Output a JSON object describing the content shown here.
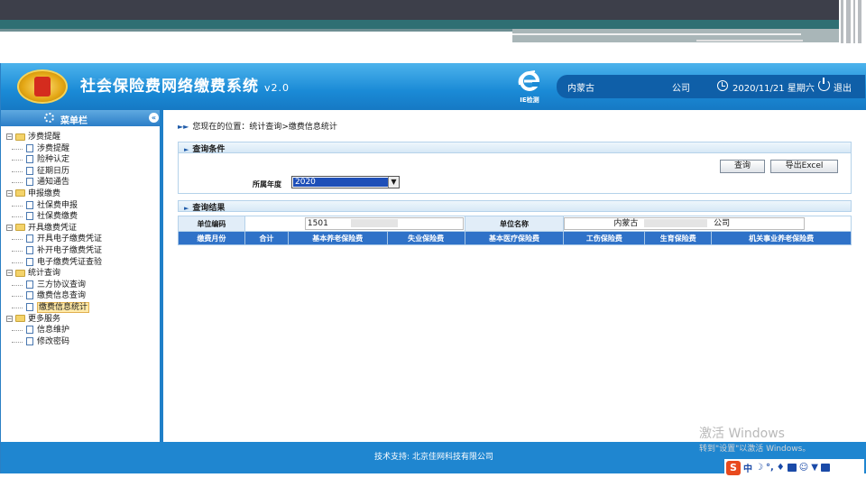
{
  "header": {
    "title": "社会保险费网络缴费系统",
    "version": "v2.0",
    "ie_label": "IE检测",
    "region": "内蒙古",
    "company": "公司",
    "date": "2020/11/21 星期六",
    "logout": "退出"
  },
  "sidebar": {
    "title": "菜单栏",
    "groups": [
      {
        "label": "涉费提醒",
        "items": [
          "涉费提醒",
          "险种认定",
          "征期日历",
          "通知通告"
        ]
      },
      {
        "label": "申报缴费",
        "items": [
          "社保费申报",
          "社保费缴费"
        ]
      },
      {
        "label": "开具缴费凭证",
        "items": [
          "开具电子缴费凭证",
          "补开电子缴费凭证",
          "电子缴费凭证查验"
        ]
      },
      {
        "label": "统计查询",
        "items": [
          "三方协议查询",
          "缴费信息查询",
          "缴费信息统计"
        ]
      },
      {
        "label": "更多服务",
        "items": [
          "信息维护",
          "修改密码"
        ]
      }
    ]
  },
  "main": {
    "breadcrumb": "您现在的位置：统计查询>缴费信息统计",
    "query_section": {
      "title": "查询条件",
      "query_button": "查询",
      "export_button": "导出Excel",
      "year_label": "所属年度",
      "year_value": "2020"
    },
    "result_section": {
      "title": "查询结果",
      "unit_code_label": "单位编码",
      "unit_code_value": "1501",
      "unit_name_label": "单位名称",
      "unit_name_prefix": "内蒙古",
      "unit_name_suffix": "公司",
      "columns": [
        "缴费月份",
        "合计",
        "基本养老保险费",
        "失业保险费",
        "基本医疗保险费",
        "工伤保险费",
        "生育保险费",
        "机关事业养老保险费"
      ]
    }
  },
  "footer": {
    "support": "技术支持: 北京佳网科技有限公司"
  },
  "watermark": {
    "title": "激活 Windows",
    "subtitle": "转到\"设置\"以激活 Windows。"
  },
  "ime": {
    "logo": "S",
    "mode": "中"
  },
  "colors": {
    "header_blue": "#1a8ad6",
    "table_header": "#2f72c8",
    "selection": "#1e4fb8",
    "footer_blue": "#1f86d0"
  }
}
